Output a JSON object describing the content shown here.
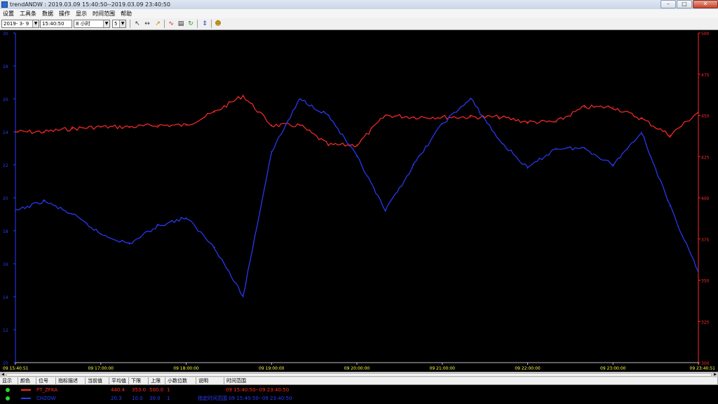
{
  "window": {
    "title": "trendANDW : 2019.03.09 15:40:50--2019.03.09 23:40:50",
    "btn_min": "–",
    "btn_max": "□",
    "btn_close": "✕"
  },
  "menu": [
    "设置",
    "工具条",
    "数据",
    "操作",
    "显示",
    "时间范围",
    "帮助"
  ],
  "toolbar": {
    "date_value": "2019- 3- 9",
    "time_value": "15:40:50",
    "span_value": "8 小时",
    "step_value": "5"
  },
  "axes": {
    "left_color": "#2a3cff",
    "right_color": "#ff2a2a",
    "left_ticks": [
      "30",
      "28",
      "26",
      "24",
      "22",
      "20",
      "18",
      "16",
      "14",
      "12",
      "10"
    ],
    "right_ticks": [
      "500",
      "475",
      "450",
      "425",
      "400",
      "375",
      "350",
      "325",
      "300"
    ],
    "x_ticks": [
      "09 15:40:51",
      "09 17:00:00",
      "09 18:00:00",
      "09 19:00:00",
      "09 20:00:00",
      "09 21:00:00",
      "09 22:00:00",
      "09 23:00:00",
      "09 23:40:51"
    ]
  },
  "chart_data": {
    "type": "line",
    "x": [
      "15:40",
      "16:00",
      "16:20",
      "16:40",
      "17:00",
      "17:20",
      "17:40",
      "18:00",
      "18:20",
      "18:40",
      "19:00",
      "19:20",
      "19:40",
      "20:00",
      "20:20",
      "20:40",
      "21:00",
      "21:20",
      "21:40",
      "22:00",
      "22:20",
      "22:40",
      "23:00",
      "23:20",
      "23:40"
    ],
    "xlim": [
      "09 15:40:51",
      "09 23:40:51"
    ],
    "series": [
      {
        "name": "PT_ZFKA",
        "axis": "right",
        "color": "#ff2a2a",
        "values": [
          440,
          440,
          442,
          443,
          443,
          444,
          444,
          452,
          462,
          444,
          444,
          432,
          432,
          450,
          449,
          449,
          449,
          449,
          446,
          446,
          455,
          455,
          448,
          438,
          452
        ]
      },
      {
        "name": "CHZOW",
        "axis": "left",
        "color": "#2a3cff",
        "values": [
          19.2,
          19.8,
          19.0,
          17.8,
          17.2,
          18.3,
          18.8,
          17.0,
          14.0,
          22.8,
          26.0,
          25.0,
          22.5,
          19.2,
          22.0,
          24.5,
          26.0,
          23.5,
          21.8,
          23.0,
          23.0,
          22.0,
          24.0,
          19.5,
          15.5
        ]
      }
    ],
    "ylim_left": [
      10,
      30
    ],
    "ylim_right": [
      300,
      500
    ],
    "grid": false
  },
  "legend_table": {
    "headers": [
      "显示",
      "颜色",
      "位号",
      "指标描述",
      "当前值",
      "平均值",
      "下限",
      "上限",
      "小数位数",
      "说明",
      "时间范围"
    ],
    "rows": [
      {
        "tag": "PT_ZFKA",
        "color": "#ff2a2a",
        "current": "440.4",
        "low": "353.0",
        "high": "500.0",
        "decimals": "1",
        "time_range": "09 15:40:50--09 23:40:50"
      },
      {
        "tag": "CHZOW",
        "color": "#2a3cff",
        "current": "20.3",
        "low": "10.0",
        "high": "30.0",
        "decimals": "1",
        "time_range": "指定时间范围 09 15:40:50--09 23:40:50"
      }
    ]
  }
}
